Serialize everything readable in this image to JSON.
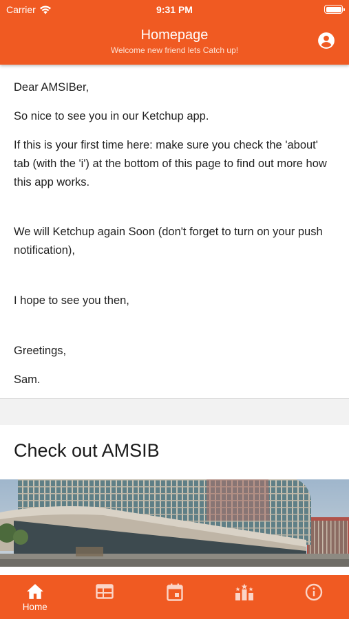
{
  "status_bar": {
    "carrier": "Carrier",
    "time": "9:31 PM"
  },
  "header": {
    "title": "Homepage",
    "subtitle": "Welcome new friend lets Catch up!",
    "account_icon": "account-circle-icon"
  },
  "message": {
    "greeting": "Dear AMSIBer,",
    "paragraphs": [
      "So nice to see you in our Ketchup app.",
      "If this is your first time here: make sure you check the 'about' tab (with the 'i') at the bottom of this page to find out more how this app works.",
      "We will Ketchup again Soon (don't forget to turn on your push notification),",
      "I hope to see you then,",
      "Greetings,"
    ],
    "signature": "Sam."
  },
  "promo": {
    "title": "Check out AMSIB"
  },
  "tab_bar": {
    "tabs": [
      {
        "label": "Home",
        "icon": "home-icon",
        "active": true
      },
      {
        "label": "",
        "icon": "schedule-icon",
        "active": false
      },
      {
        "label": "",
        "icon": "calendar-icon",
        "active": false
      },
      {
        "label": "",
        "icon": "leaderboard-icon",
        "active": false
      },
      {
        "label": "",
        "icon": "info-icon",
        "active": false
      }
    ]
  },
  "colors": {
    "brand": "#f05a22",
    "background": "#f2f2f2",
    "text": "#222222"
  }
}
